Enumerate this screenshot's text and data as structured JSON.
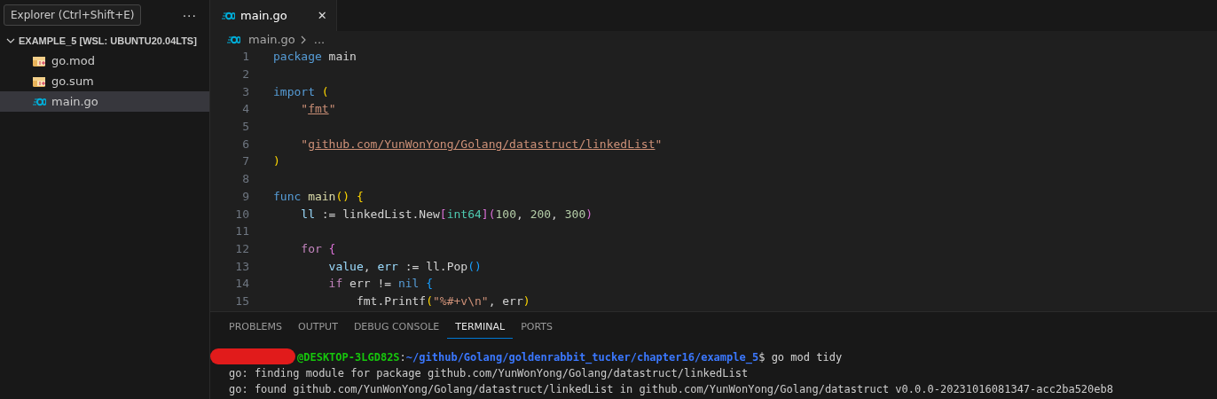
{
  "tooltip": {
    "text": "Explorer (Ctrl+Shift+E)"
  },
  "sidebar": {
    "more": "···",
    "folder": {
      "label": "EXAMPLE_5 [WSL: UBUNTU20.04LTS]",
      "expanded": true,
      "children": [
        {
          "label": "go.mod",
          "kind": "mod",
          "selected": false
        },
        {
          "label": "go.sum",
          "kind": "mod",
          "selected": false
        },
        {
          "label": "main.go",
          "kind": "go",
          "selected": true
        }
      ]
    }
  },
  "editor": {
    "tabs": [
      {
        "label": "main.go",
        "selected": true,
        "close": "✕"
      }
    ],
    "breadcrumb": [
      "main.go",
      "..."
    ],
    "lines": [
      {
        "number": "1",
        "tokens": [
          {
            "text": "package",
            "kind": "kw"
          },
          {
            "text": " main",
            "kind": "plain"
          }
        ]
      },
      {
        "number": "2"
      },
      {
        "number": "3",
        "tokens": [
          {
            "text": "import",
            "kind": "kw"
          },
          {
            "text": " (",
            "kind": "b1"
          }
        ]
      },
      {
        "number": "4",
        "tokens": [
          {
            "text": "    \"",
            "kind": "str"
          },
          {
            "text": "fmt",
            "kind": "strl"
          },
          {
            "text": "\"",
            "kind": "str"
          }
        ]
      },
      {
        "number": "5"
      },
      {
        "number": "6",
        "tokens": [
          {
            "text": "    \"",
            "kind": "str"
          },
          {
            "text": "github.com/YunWonYong/Golang/datastruct/linkedList",
            "kind": "strl"
          },
          {
            "text": "\"",
            "kind": "str"
          }
        ]
      },
      {
        "number": "7",
        "tokens": [
          {
            "text": ")",
            "kind": "b1"
          }
        ]
      },
      {
        "number": "8"
      },
      {
        "number": "9",
        "tokens": [
          {
            "text": "func",
            "kind": "kw"
          },
          {
            "text": " main",
            "kind": "fn"
          },
          {
            "text": "() {",
            "kind": "b1"
          }
        ]
      },
      {
        "number": "10",
        "tokens": [
          {
            "text": "    ll",
            "kind": "var"
          },
          {
            "text": " := linkedList.New",
            "kind": "plain"
          },
          {
            "text": "[",
            "kind": "b2"
          },
          {
            "text": "int64",
            "kind": "type"
          },
          {
            "text": "]",
            "kind": "b2"
          },
          {
            "text": "(",
            "kind": "b2"
          },
          {
            "text": "100",
            "kind": "num"
          },
          {
            "text": ", ",
            "kind": "plain"
          },
          {
            "text": "200",
            "kind": "num"
          },
          {
            "text": ", ",
            "kind": "plain"
          },
          {
            "text": "300",
            "kind": "num"
          },
          {
            "text": ")",
            "kind": "b2"
          }
        ]
      },
      {
        "number": "11"
      },
      {
        "number": "12",
        "tokens": [
          {
            "text": "    for",
            "kind": "ctl"
          },
          {
            "text": " {",
            "kind": "b2"
          }
        ]
      },
      {
        "number": "13",
        "tokens": [
          {
            "text": "        value",
            "kind": "var"
          },
          {
            "text": ", ",
            "kind": "plain"
          },
          {
            "text": "err",
            "kind": "var"
          },
          {
            "text": " := ll.Pop",
            "kind": "plain"
          },
          {
            "text": "()",
            "kind": "b3"
          }
        ]
      },
      {
        "number": "14",
        "tokens": [
          {
            "text": "        if",
            "kind": "ctl"
          },
          {
            "text": " err != ",
            "kind": "plain"
          },
          {
            "text": "nil",
            "kind": "kw"
          },
          {
            "text": " {",
            "kind": "b3"
          }
        ]
      },
      {
        "number": "15",
        "tokens": [
          {
            "text": "            fmt.Printf",
            "kind": "plain"
          },
          {
            "text": "(",
            "kind": "b1"
          },
          {
            "text": "\"%#+v\\n\"",
            "kind": "str"
          },
          {
            "text": ", err",
            "kind": "plain"
          },
          {
            "text": ")",
            "kind": "b1"
          }
        ]
      }
    ]
  },
  "panel": {
    "tabs": [
      {
        "label": "PROBLEMS",
        "selected": false
      },
      {
        "label": "OUTPUT",
        "selected": false
      },
      {
        "label": "DEBUG CONSOLE",
        "selected": false
      },
      {
        "label": "TERMINAL",
        "selected": true
      },
      {
        "label": "PORTS",
        "selected": false
      }
    ],
    "terminal": [
      {
        "kind": "prompt",
        "host": "@DESKTOP-3LGD82S",
        "sep": ":",
        "path": "~/github/Golang/goldenrabbit_tucker/chapter16/example_5",
        "command": "$ go mod tidy"
      },
      {
        "kind": "output",
        "text": "go: finding module for package github.com/YunWonYong/Golang/datastruct/linkedList"
      },
      {
        "kind": "output",
        "text": "go: found github.com/YunWonYong/Golang/datastruct/linkedList in github.com/YunWonYong/Golang/datastruct v0.0.0-20231016081347-acc2ba520eb8"
      }
    ]
  }
}
